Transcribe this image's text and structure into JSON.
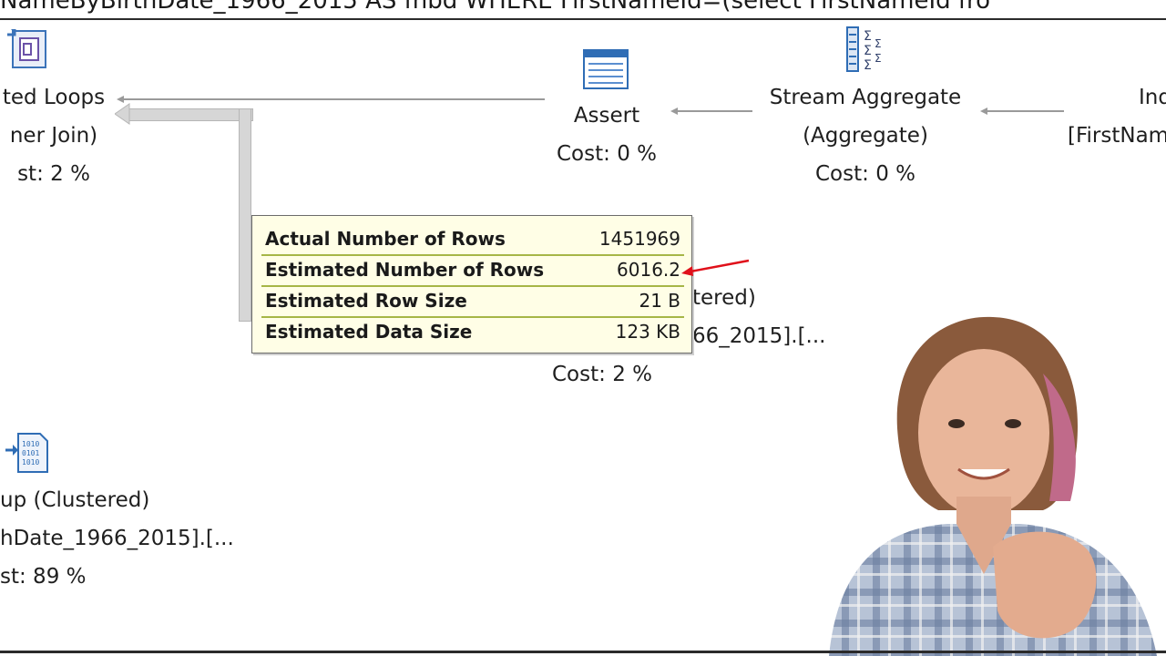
{
  "query": {
    "text": "NameByBirthDate_1966_2015 AS fnbd WHERE FirstNameId=(select FirstNameId fro"
  },
  "operators": {
    "nested_loops": {
      "icon": "nested-loops-icon",
      "line1": "ted Loops",
      "line2": "ner Join)",
      "cost": "st: 2 %"
    },
    "assert": {
      "icon": "assert-icon",
      "line1": "Assert",
      "cost": "Cost: 0 %"
    },
    "stream_aggregate": {
      "icon": "stream-aggregate-icon",
      "line1": "Stream Aggregate",
      "line2": "(Aggregate)",
      "cost": "Cost: 0 %"
    },
    "index_right": {
      "line1": "Ind",
      "line2": "[FirstNam"
    },
    "index_seek_middle": {
      "line1": "tered)",
      "line2": "66_2015].[...",
      "cost": "Cost: 2 %"
    },
    "key_lookup": {
      "icon": "key-lookup-icon",
      "line1": "up (Clustered)",
      "line2": "hDate_1966_2015].[...",
      "cost": "st: 89 %"
    }
  },
  "tooltip": {
    "rows": [
      {
        "key": "Actual Number of Rows",
        "value": "1451969"
      },
      {
        "key": "Estimated Number of Rows",
        "value": "6016.2"
      },
      {
        "key": "Estimated Row Size",
        "value": "21 B"
      },
      {
        "key": "Estimated Data Size",
        "value": "123 KB"
      }
    ]
  },
  "colors": {
    "tooltip_bg": "#fffee6",
    "tooltip_divider": "#a6b646",
    "annotation_arrow": "#e0101a",
    "connector": "#9a9a9a"
  }
}
